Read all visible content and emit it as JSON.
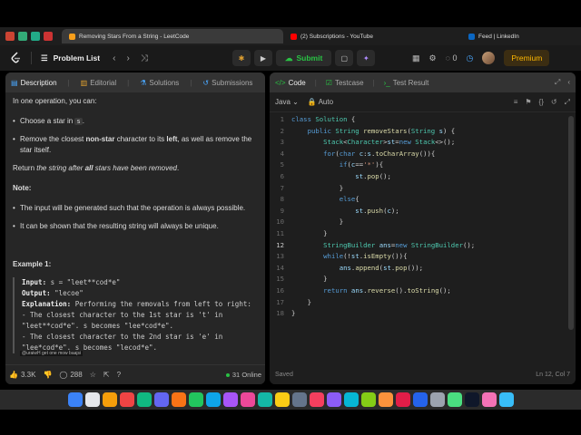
{
  "browser": {
    "tabs": [
      {
        "label": "Removing Stars From a String - LeetCode",
        "active": true
      },
      {
        "label": "(2) Subscriptions - YouTube",
        "active": false
      },
      {
        "label": "Feed | LinkedIn",
        "active": false
      }
    ]
  },
  "header": {
    "problem_list": "Problem List",
    "submit": "Submit",
    "notifications_count": "0",
    "premium": "Premium"
  },
  "left_tabs": [
    "Description",
    "Editorial",
    "Solutions",
    "Submissions"
  ],
  "description": {
    "intro": "In one operation, you can:",
    "ops": [
      {
        "pre": "Choose a star in ",
        "code": "s",
        "post": "."
      },
      {
        "pre": "Remove the closest ",
        "bold1": "non-star",
        "mid": " character to its ",
        "bold2": "left",
        "post": ", as well as remove the star itself."
      }
    ],
    "return_pre": "Return ",
    "return_em": "the string after ",
    "return_bold": "all",
    "return_post": " stars have been removed",
    "note_title": "Note:",
    "notes": [
      "The input will be generated such that the operation is always possible.",
      "It can be shown that the resulting string will always be unique."
    ],
    "example_title": "Example 1:",
    "example": {
      "input_label": "Input:",
      "input_value": "s = \"leet**cod*e\"",
      "output_label": "Output:",
      "output_value": "\"lecoe\"",
      "explanation_label": "Explanation:",
      "explanation_lines": [
        "Performing the removals from left to right:",
        "- The closest character to the 1st star is 't' in",
        "\"leet**cod*e\". s becomes \"lee*cod*e\".",
        "- The closest character to the 2nd star is 'e' in",
        "\"lee*cod*e\". s becomes \"lecod*e\"."
      ]
    },
    "watermark": "@uraiwH get one mow baajsi"
  },
  "left_footer": {
    "likes": "3.3K",
    "comments": "288",
    "online": "31 Online"
  },
  "right_tabs": [
    "Code",
    "Testcase",
    "Test Result"
  ],
  "editor": {
    "language": "Java",
    "mode": "Auto",
    "status_left": "Saved",
    "status_right": "Ln 12, Col 7",
    "current_line": 12,
    "lines": [
      [
        [
          "kw",
          "class"
        ],
        [
          "pl",
          " "
        ],
        [
          "ty",
          "Solution"
        ],
        [
          "pl",
          " {"
        ]
      ],
      [
        [
          "pl",
          "    "
        ],
        [
          "kw",
          "public"
        ],
        [
          "pl",
          " "
        ],
        [
          "ty",
          "String"
        ],
        [
          "pl",
          " "
        ],
        [
          "fn",
          "removeStars"
        ],
        [
          "pl",
          "("
        ],
        [
          "ty",
          "String"
        ],
        [
          "pl",
          " "
        ],
        [
          "var",
          "s"
        ],
        [
          "pl",
          ") {"
        ]
      ],
      [
        [
          "pl",
          "        "
        ],
        [
          "ty",
          "Stack"
        ],
        [
          "pl",
          "<"
        ],
        [
          "ty",
          "Character"
        ],
        [
          "pl",
          ">"
        ],
        [
          "var",
          "st"
        ],
        [
          "pl",
          "="
        ],
        [
          "kw",
          "new"
        ],
        [
          "pl",
          " "
        ],
        [
          "ty",
          "Stack"
        ],
        [
          "pl",
          "<>();"
        ]
      ],
      [
        [
          "pl",
          "        "
        ],
        [
          "kw",
          "for"
        ],
        [
          "pl",
          "("
        ],
        [
          "kw",
          "char"
        ],
        [
          "pl",
          " "
        ],
        [
          "var",
          "c"
        ],
        [
          "pl",
          ":"
        ],
        [
          "var",
          "s"
        ],
        [
          "pl",
          "."
        ],
        [
          "fn",
          "toCharArray"
        ],
        [
          "pl",
          "()){"
        ]
      ],
      [
        [
          "pl",
          "            "
        ],
        [
          "kw",
          "if"
        ],
        [
          "pl",
          "("
        ],
        [
          "var",
          "c"
        ],
        [
          "pl",
          "=="
        ],
        [
          "str",
          "'*'"
        ],
        [
          "pl",
          "){"
        ]
      ],
      [
        [
          "pl",
          "                "
        ],
        [
          "var",
          "st"
        ],
        [
          "pl",
          "."
        ],
        [
          "fn",
          "pop"
        ],
        [
          "pl",
          "();"
        ]
      ],
      [
        [
          "pl",
          "            }"
        ]
      ],
      [
        [
          "pl",
          "            "
        ],
        [
          "kw",
          "else"
        ],
        [
          "pl",
          "{"
        ]
      ],
      [
        [
          "pl",
          "                "
        ],
        [
          "var",
          "st"
        ],
        [
          "pl",
          "."
        ],
        [
          "fn",
          "push"
        ],
        [
          "pl",
          "("
        ],
        [
          "var",
          "c"
        ],
        [
          "pl",
          ");"
        ]
      ],
      [
        [
          "pl",
          "            }"
        ]
      ],
      [
        [
          "pl",
          "        }"
        ]
      ],
      [
        [
          "pl",
          "        "
        ],
        [
          "ty",
          "StringBuilder"
        ],
        [
          "pl",
          " "
        ],
        [
          "var",
          "ans"
        ],
        [
          "pl",
          "="
        ],
        [
          "kw",
          "new"
        ],
        [
          "pl",
          " "
        ],
        [
          "ty",
          "StringBuilder"
        ],
        [
          "pl",
          "();"
        ]
      ],
      [
        [
          "pl",
          "        "
        ],
        [
          "kw",
          "while"
        ],
        [
          "pl",
          "(!"
        ],
        [
          "var",
          "st"
        ],
        [
          "pl",
          "."
        ],
        [
          "fn",
          "isEmpty"
        ],
        [
          "pl",
          "()){"
        ]
      ],
      [
        [
          "pl",
          "            "
        ],
        [
          "var",
          "ans"
        ],
        [
          "pl",
          "."
        ],
        [
          "fn",
          "append"
        ],
        [
          "pl",
          "("
        ],
        [
          "var",
          "st"
        ],
        [
          "pl",
          "."
        ],
        [
          "fn",
          "pop"
        ],
        [
          "pl",
          "());"
        ]
      ],
      [
        [
          "pl",
          "        }"
        ]
      ],
      [
        [
          "pl",
          "        "
        ],
        [
          "kw",
          "return"
        ],
        [
          "pl",
          " "
        ],
        [
          "var",
          "ans"
        ],
        [
          "pl",
          "."
        ],
        [
          "fn",
          "reverse"
        ],
        [
          "pl",
          "()."
        ],
        [
          "fn",
          "toString"
        ],
        [
          "pl",
          "();"
        ]
      ],
      [
        [
          "pl",
          "    }"
        ]
      ],
      [
        [
          "pl",
          "}"
        ]
      ]
    ]
  },
  "icons": {
    "logo": "leetcode-logo-icon",
    "list": "list-icon",
    "prev": "chevron-left-icon",
    "next": "chevron-right-icon",
    "shuffle": "shuffle-icon"
  }
}
